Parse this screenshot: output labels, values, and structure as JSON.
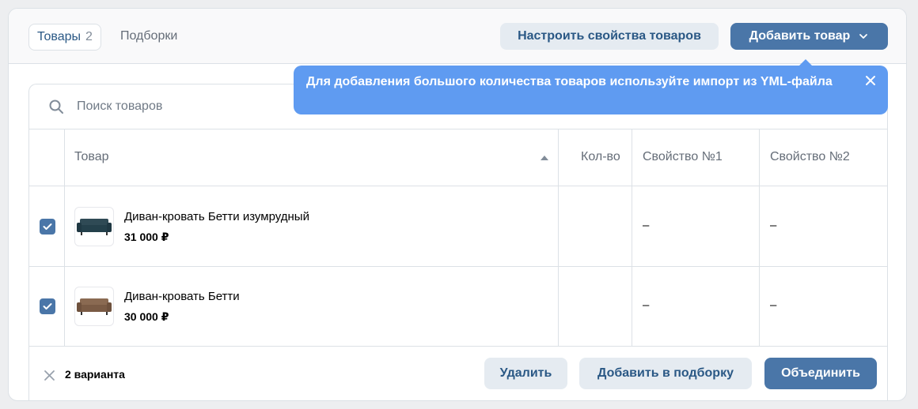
{
  "header": {
    "tabs": [
      {
        "label": "Товары",
        "count": "2",
        "active": true
      },
      {
        "label": "Подборки",
        "active": false
      }
    ],
    "configure_button": "Настроить свойства товаров",
    "add_button": "Добавить товар"
  },
  "tooltip": {
    "text": "Для добавления большого количества товаров используйте импорт из YML-файла"
  },
  "search": {
    "placeholder": "Поиск товаров"
  },
  "table": {
    "columns": [
      "Товар",
      "Кол-во",
      "Свойство №1",
      "Свойство №2"
    ],
    "sort_column": "Товар",
    "rows": [
      {
        "name": "Диван-кровать Бетти изумрудный",
        "price": "31 000 ₽",
        "quantity": "",
        "property1": "–",
        "property2": "–",
        "checked": true,
        "thumb_color": "#2f4a55"
      },
      {
        "name": "Диван-кровать Бетти",
        "price": "30 000 ₽",
        "quantity": "",
        "property1": "–",
        "property2": "–",
        "checked": true,
        "thumb_color": "#8a6a52"
      }
    ]
  },
  "footer": {
    "selection_count": "2 варианта",
    "delete_button": "Удалить",
    "add_to_collection_button": "Добавить в подборку",
    "merge_button": "Объединить"
  },
  "colors": {
    "accent": "#4a76a8",
    "tooltip": "#5f9bf1",
    "secondary_button": "#e5ebf1"
  }
}
